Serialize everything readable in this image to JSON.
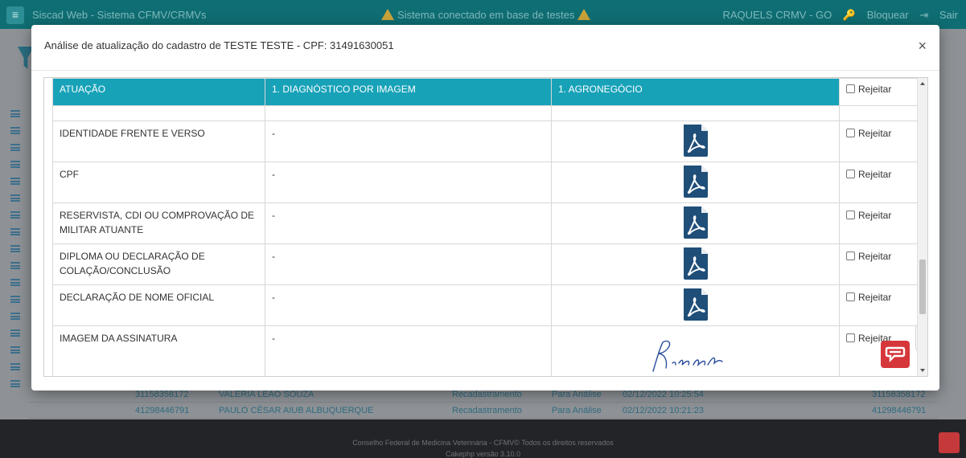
{
  "app": {
    "title": "Siscad Web - Sistema CFMV/CRMVs",
    "env_warning": "Sistema conectado em base de testes",
    "user": "RAQUELS CRMV - GO",
    "lock_label": "Bloquear",
    "logout_label": "Sair"
  },
  "modal": {
    "title": "Análise de atualização do cadastro de TESTE TESTE - CPF: 31491630051",
    "close_label": "×",
    "table": {
      "headers": [
        "ATUAÇÃO",
        "1. DIAGNÓSTICO POR IMAGEM",
        "1. AGRONEGÓCIO"
      ],
      "reject_label": "Rejeitar",
      "rows": [
        {
          "label": "IDENTIDADE FRENTE E VERSO",
          "col2": "-",
          "col3": "pdf-icon"
        },
        {
          "label": "CPF",
          "col2": "-",
          "col3": "pdf-icon"
        },
        {
          "label": "RESERVISTA, CDI OU COMPROVAÇÃO DE MILITAR ATUANTE",
          "col2": "-",
          "col3": "pdf-icon"
        },
        {
          "label": "DIPLOMA OU DECLARAÇÃO DE COLAÇÃO/CONCLUSÃO",
          "col2": "-",
          "col3": "pdf-icon"
        },
        {
          "label": "DECLARAÇÃO DE NOME OFICIAL",
          "col2": "-",
          "col3": "pdf-icon"
        },
        {
          "label": "IMAGEM DA ASSINATURA",
          "col2": "-",
          "col3": "signature-image"
        }
      ]
    }
  },
  "background_list": {
    "rows": [
      {
        "cpf": "31158358172",
        "name": "VALERIA LEAO SOUZA",
        "type": "Recadastramento",
        "status": "Para Análise",
        "date": "02/12/2022 10:25:54",
        "cpf2": "31158358172"
      },
      {
        "cpf": "41298446791",
        "name": "PAULO CÉSAR AIUB ALBUQUERQUE",
        "type": "Recadastramento",
        "status": "Para Análise",
        "date": "02/12/2022 10:21:23",
        "cpf2": "41298446791"
      }
    ]
  },
  "footer": {
    "copyright": "Conselho Federal de Medicina Veterinária - CFMV© Todos os direitos reservados",
    "version": "Cakephp versão 3.10.0"
  },
  "colors": {
    "header_bg": "#0f6e73",
    "table_header": "#17a2b8",
    "pdf_icon": "#1f4e79",
    "chat_widget": "#d6373b"
  }
}
